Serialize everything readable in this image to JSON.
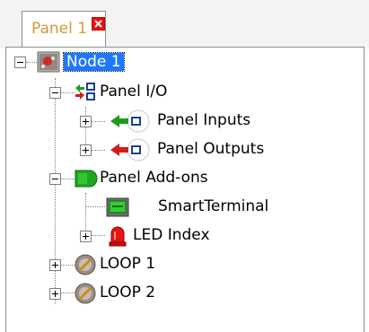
{
  "tab": {
    "label": "Panel 1"
  },
  "tree": {
    "root": {
      "label": "Node 1"
    },
    "panel_io": {
      "label": "Panel I/O"
    },
    "panel_inputs": {
      "label": "Panel Inputs"
    },
    "panel_outputs": {
      "label": "Panel Outputs"
    },
    "panel_addons": {
      "label": "Panel Add-ons"
    },
    "smart_terminal": {
      "label": "SmartTerminal"
    },
    "led_index": {
      "label": "LED Index"
    },
    "loop1": {
      "label": "LOOP 1"
    },
    "loop2": {
      "label": "LOOP 2"
    }
  },
  "colors": {
    "selection": "#1e78ff",
    "tab_label": "#d49a3b",
    "close": "#f10c0c"
  }
}
